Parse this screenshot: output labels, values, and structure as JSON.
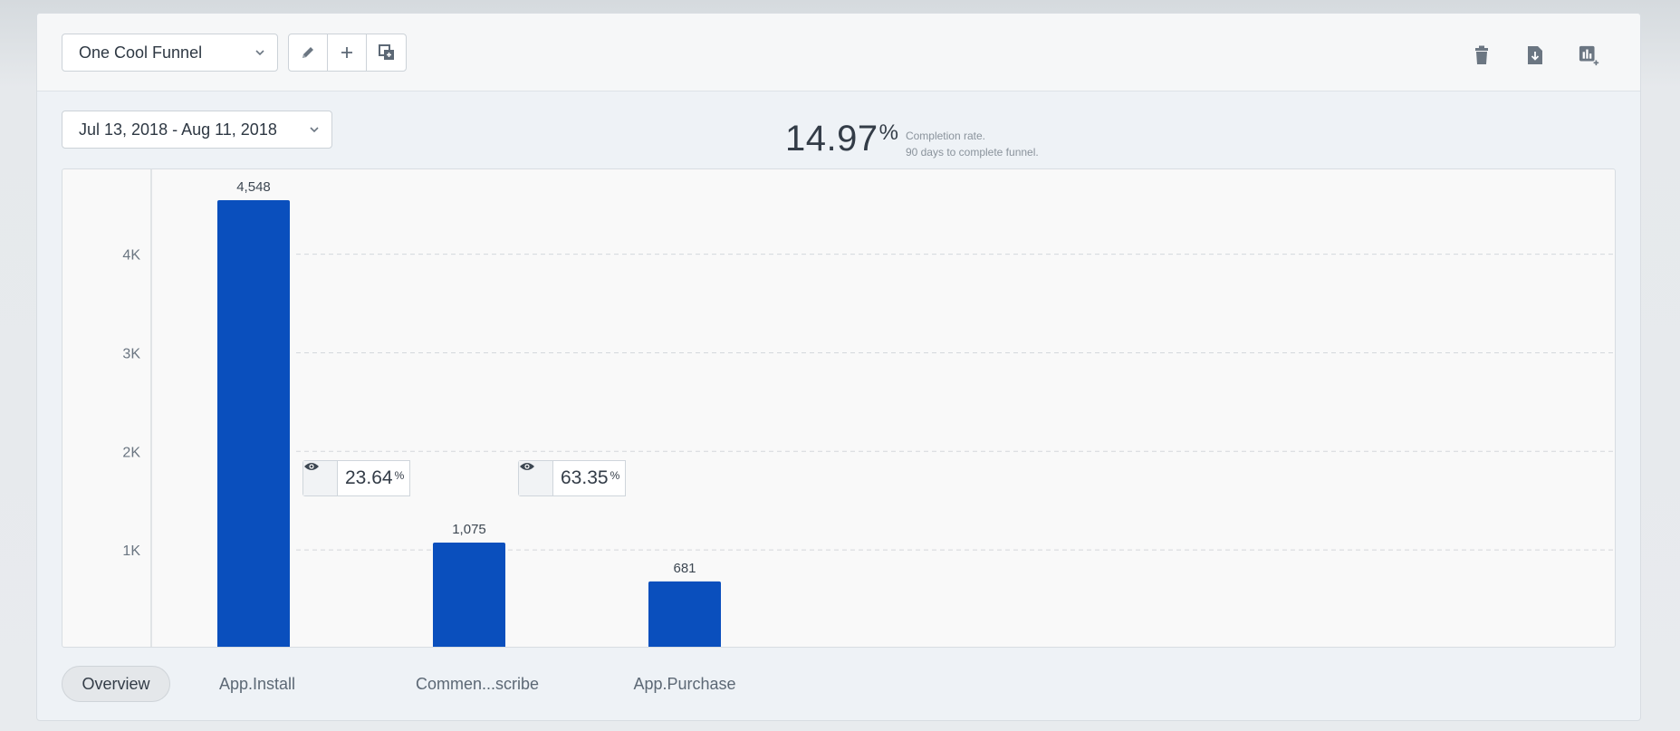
{
  "toolbar": {
    "funnel_name": "One Cool Funnel",
    "edit_icon": "pencil-icon",
    "add_icon": "plus-icon",
    "duplicate_icon": "duplicate-icon",
    "delete_icon": "trash-icon",
    "export_icon": "download-file-icon",
    "add_to_dashboard_icon": "chart-add-icon"
  },
  "date_range": "Jul 13, 2018 - Aug 11, 2018",
  "completion": {
    "value": "14.97",
    "percent_sign": "%",
    "label": "Completion rate.",
    "sub_label": "90 days to complete funnel."
  },
  "conversions": [
    {
      "value": "23.64",
      "sign": "%"
    },
    {
      "value": "63.35",
      "sign": "%"
    }
  ],
  "tabs": [
    {
      "label": "Overview",
      "active": true
    },
    {
      "label": "App.Install",
      "active": false
    },
    {
      "label": "Commen...scribe",
      "active": false
    },
    {
      "label": "App.Purchase",
      "active": false
    }
  ],
  "colors": {
    "bar": "#0a4fbd",
    "grid": "#d4d8dc"
  },
  "chart_data": {
    "type": "bar",
    "categories": [
      "App.Install",
      "Commen...scribe",
      "App.Purchase"
    ],
    "values": [
      4548,
      1075,
      681
    ],
    "value_labels": [
      "4,548",
      "1,075",
      "681"
    ],
    "y_ticks": [
      1000,
      2000,
      3000,
      4000
    ],
    "y_tick_labels": [
      "1K",
      "2K",
      "3K",
      "4K"
    ],
    "ylim": [
      0,
      4860
    ],
    "grid": true
  }
}
